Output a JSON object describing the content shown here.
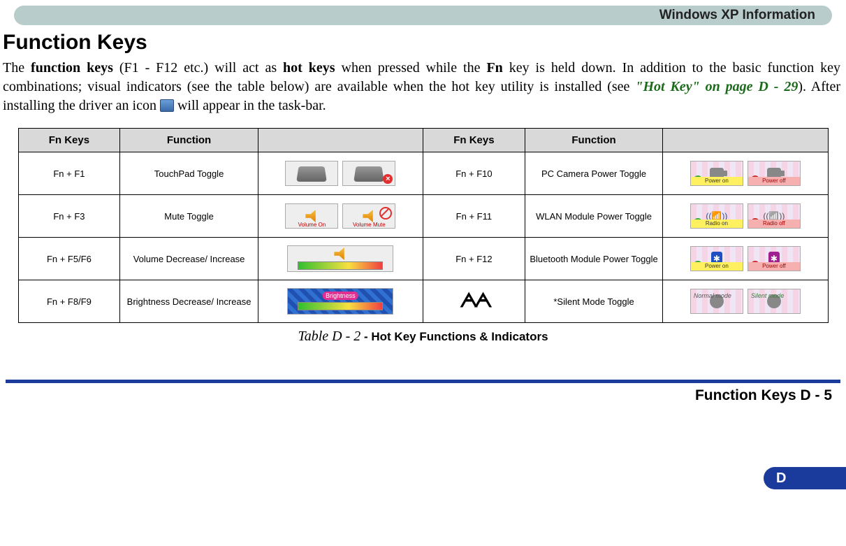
{
  "header": {
    "section_title": "Windows XP Information"
  },
  "title": "Function Keys",
  "intro": {
    "t1": "The ",
    "b1": "function keys",
    "t2": " (F1 - F12 etc.) will act as ",
    "b2": "hot keys",
    "t3": " when pressed while the ",
    "b3": "Fn",
    "t4": " key is held down. In addition to the basic function key combinations; visual indicators (see the table below) are available when the hot key utility is installed (see ",
    "xref": "\"Hot Key\" on page D - 29",
    "t5": "). After installing the driver an icon ",
    "t6": " will appear in the task-bar."
  },
  "table": {
    "headers": {
      "fn_keys": "Fn Keys",
      "function": "Function"
    },
    "rows": [
      {
        "left_key": "Fn + F1",
        "left_fn": "TouchPad Toggle",
        "left_ind": {
          "type": "touchpad"
        },
        "right_key": "Fn + F10",
        "right_fn": "PC Camera Power Toggle",
        "right_ind": {
          "type": "camera",
          "on_label": "Power on",
          "off_label": "Power off"
        }
      },
      {
        "left_key": "Fn + F3",
        "left_fn": "Mute Toggle",
        "left_ind": {
          "type": "mute",
          "on_label": "Volume    On",
          "off_label": "Volume    Mute"
        },
        "right_key": "Fn + F11",
        "right_fn": "WLAN Module Power Toggle",
        "right_ind": {
          "type": "wlan",
          "on_label": "Radio on",
          "off_label": "Radio off"
        }
      },
      {
        "left_key": "Fn + F5/F6",
        "left_fn": "Volume Decrease/ Increase",
        "left_ind": {
          "type": "volume"
        },
        "right_key": "Fn + F12",
        "right_fn": "Bluetooth Module Power Toggle",
        "right_ind": {
          "type": "bluetooth",
          "on_label": "Power on",
          "off_label": "Power off"
        }
      },
      {
        "left_key": "Fn + F8/F9",
        "left_fn": "Brightness Decrease/ Increase",
        "left_ind": {
          "type": "brightness",
          "label": "Brightness"
        },
        "right_key_icon": true,
        "right_fn": "*Silent Mode Toggle",
        "right_ind": {
          "type": "silent",
          "on_label": "Normal mode",
          "off_label": "Silent mode"
        }
      }
    ]
  },
  "caption": {
    "prefix": "Table D - 2",
    "suffix": " - Hot Key Functions & Indicators"
  },
  "side_tab": "D",
  "footer": "Function Keys  D  -  5"
}
